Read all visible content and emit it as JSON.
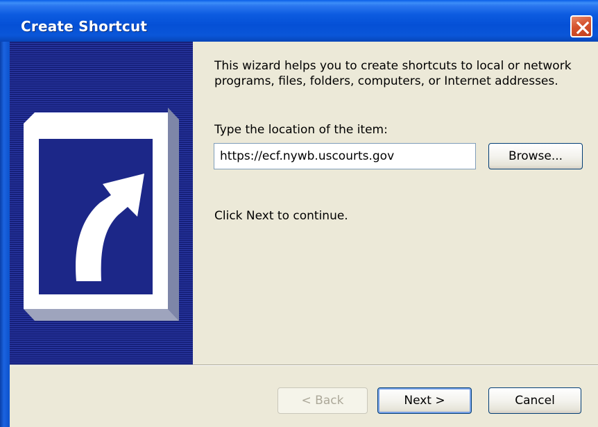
{
  "window": {
    "title": "Create Shortcut",
    "close_icon": "close-icon"
  },
  "banner": {
    "icon": "shortcut-arrow-icon"
  },
  "content": {
    "intro": "This wizard helps you to create shortcuts to local or network programs, files, folders, computers, or Internet addresses.",
    "location_label": "Type the location of the item:",
    "location_value": "https://ecf.nywb.uscourts.gov",
    "browse_label": "Browse...",
    "continue_text": "Click Next to continue."
  },
  "footer": {
    "back_label": "< Back",
    "next_label": "Next >",
    "cancel_label": "Cancel"
  },
  "colors": {
    "titlebar": "#0550d6",
    "dialog_bg": "#ece9d8",
    "banner_bg": "#1f2c8f",
    "close_button": "#d5522d"
  }
}
